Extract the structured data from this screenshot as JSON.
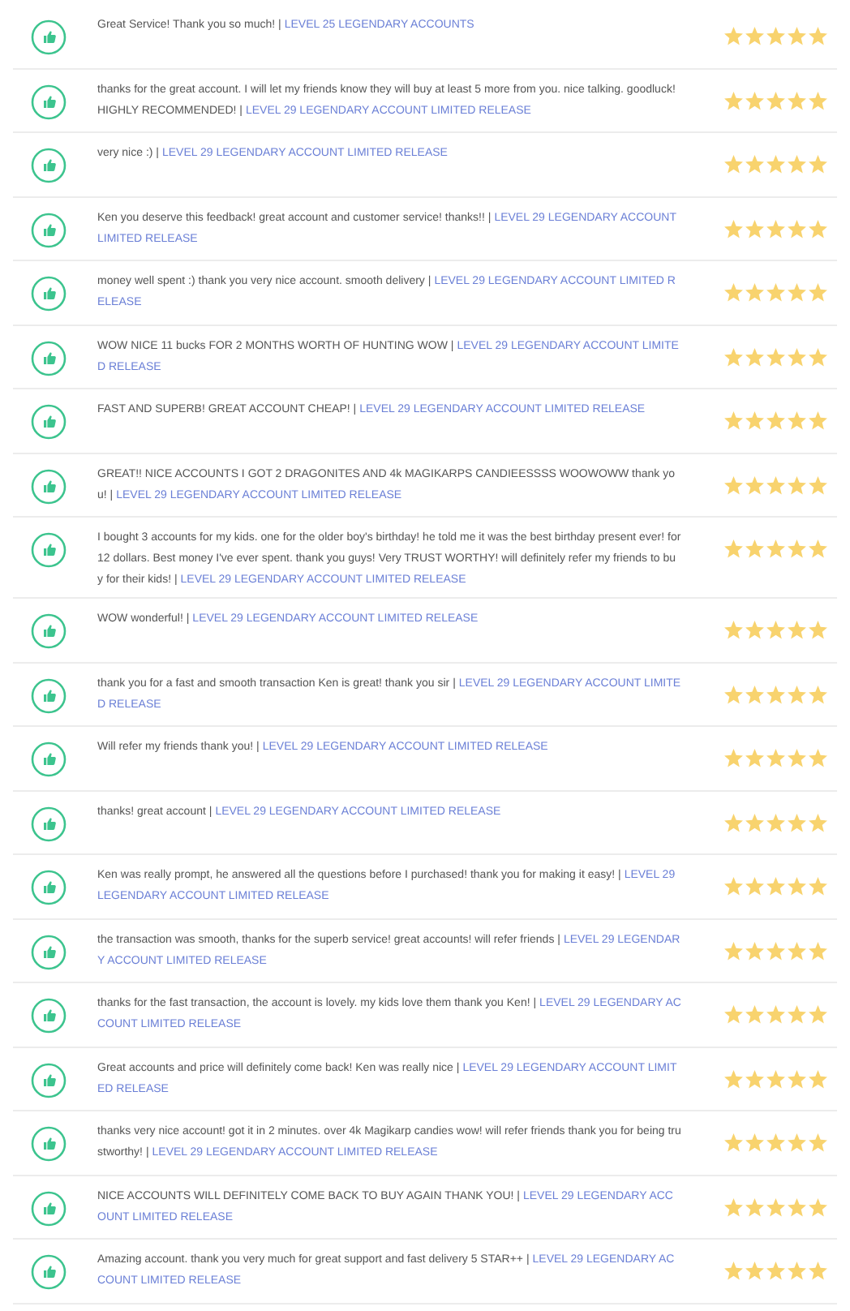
{
  "reviews": [
    {
      "comment": "Great Service! Thank you so much! |",
      "product": "LEVEL 25 LEGENDARY ACCOUNTS",
      "stars": 5
    },
    {
      "comment": "thanks for the great account. I will let my friends know they will buy at least 5 more from you. nice talking. goodluck! HIGHLY RECOMMENDED! |",
      "product": "LEVEL 29 LEGENDARY ACCOUNT LIMITED RELEASE",
      "stars": 5
    },
    {
      "comment": "very nice :) |",
      "product": "LEVEL 29 LEGENDARY ACCOUNT LIMITED RELEASE",
      "stars": 5
    },
    {
      "comment": "Ken you deserve this feedback! great account and customer service! thanks!! |",
      "product": "LEVEL 29 LEGENDARY ACCOUNT LIMITED RELEASE",
      "stars": 5
    },
    {
      "comment": "money well spent :) thank you very nice account. smooth delivery |",
      "product": "LEVEL 29 LEGENDARY ACCOUNT LIMITED RELEASE",
      "stars": 5
    },
    {
      "comment": "WOW NICE 11 bucks FOR 2 MONTHS WORTH OF HUNTING WOW |",
      "product": "LEVEL 29 LEGENDARY ACCOUNT LIMITED RELEASE",
      "stars": 5
    },
    {
      "comment": "FAST AND SUPERB! GREAT ACCOUNT CHEAP! |",
      "product": "LEVEL 29 LEGENDARY ACCOUNT LIMITED RELEASE",
      "stars": 5
    },
    {
      "comment": "GREAT!! NICE ACCOUNTS I GOT 2 DRAGONITES AND 4k MAGIKARPS CANDIEESSSS WOOWOWW thank you! |",
      "product": "LEVEL 29 LEGENDARY ACCOUNT LIMITED RELEASE",
      "stars": 5
    },
    {
      "comment": "I bought 3 accounts for my kids. one for the older boy's birthday! he told me it was the best birthday present ever! for 12 dollars. Best money I've ever spent. thank you guys! Very TRUST WORTHY! will definitely refer my friends to buy for their kids! |",
      "product": "LEVEL 29 LEGENDARY ACCOUNT LIMITED RELEASE",
      "stars": 5
    },
    {
      "comment": "WOW wonderful! |",
      "product": "LEVEL 29 LEGENDARY ACCOUNT LIMITED RELEASE",
      "stars": 5
    },
    {
      "comment": "thank you for a fast and smooth transaction Ken is great! thank you sir |",
      "product": "LEVEL 29 LEGENDARY ACCOUNT LIMITED RELEASE",
      "stars": 5
    },
    {
      "comment": "Will refer my friends thank you! |",
      "product": "LEVEL 29 LEGENDARY ACCOUNT LIMITED RELEASE",
      "stars": 5
    },
    {
      "comment": "thanks! great account |",
      "product": "LEVEL 29 LEGENDARY ACCOUNT LIMITED RELEASE",
      "stars": 5
    },
    {
      "comment": "Ken was really prompt, he answered all the questions before I purchased! thank you for making it easy! |",
      "product": "LEVEL 29 LEGENDARY ACCOUNT LIMITED RELEASE",
      "stars": 5
    },
    {
      "comment": "the transaction was smooth, thanks for the superb service! great accounts! will refer friends |",
      "product": "LEVEL 29 LEGENDARY ACCOUNT LIMITED RELEASE",
      "stars": 5
    },
    {
      "comment": "thanks for the fast transaction, the account is lovely. my kids love them thank you Ken! |",
      "product": "LEVEL 29 LEGENDARY ACCOUNT LIMITED RELEASE",
      "stars": 5
    },
    {
      "comment": "Great accounts and price will definitely come back! Ken was really nice |",
      "product": "LEVEL 29 LEGENDARY ACCOUNT LIMITED RELEASE",
      "stars": 5
    },
    {
      "comment": "thanks very nice account! got it in 2 minutes. over 4k Magikarp candies wow! will refer friends thank you for being trustworthy! |",
      "product": "LEVEL 29 LEGENDARY ACCOUNT LIMITED RELEASE",
      "stars": 5
    },
    {
      "comment": "NICE ACCOUNTS WILL DEFINITELY COME BACK TO BUY AGAIN THANK YOU! |",
      "product": "LEVEL 29 LEGENDARY ACCOUNT LIMITED RELEASE",
      "stars": 5
    },
    {
      "comment": "Amazing account. thank you very much for great support and fast delivery 5 STAR++ |",
      "product": "LEVEL 29 LEGENDARY ACCOUNT LIMITED RELEASE",
      "stars": 5
    }
  ]
}
